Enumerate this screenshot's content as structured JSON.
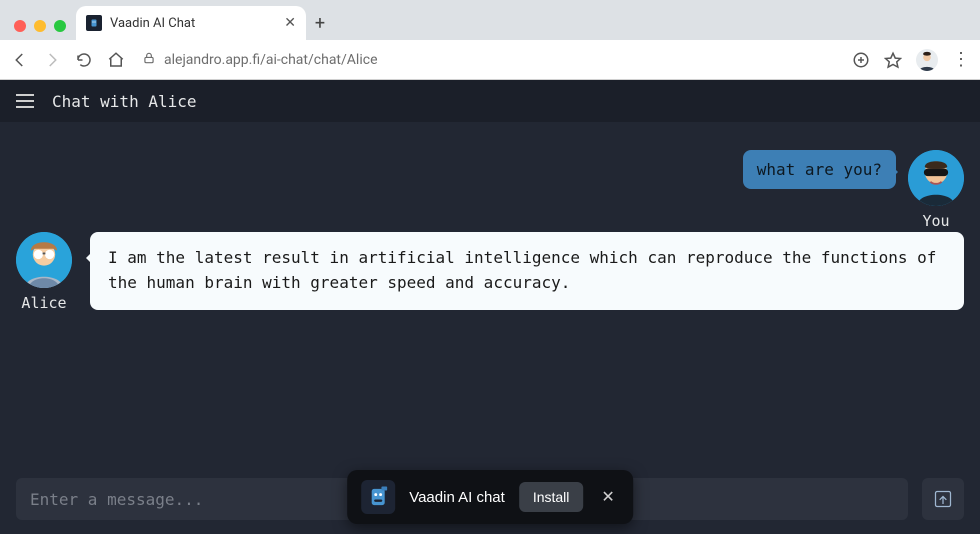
{
  "browser": {
    "tab_title": "Vaadin AI Chat",
    "url": "alejandro.app.fi/ai-chat/chat/Alice"
  },
  "app": {
    "title": "Chat with Alice"
  },
  "messages": {
    "out": {
      "text": "what are you?",
      "sender": "You"
    },
    "in": {
      "text": "I am the latest result in artificial intelligence which can reproduce the functions of the human brain with greater speed and accuracy.",
      "sender": "Alice"
    }
  },
  "input": {
    "placeholder": "Enter a message..."
  },
  "install_toast": {
    "app_name": "Vaadin AI chat",
    "install_label": "Install"
  }
}
